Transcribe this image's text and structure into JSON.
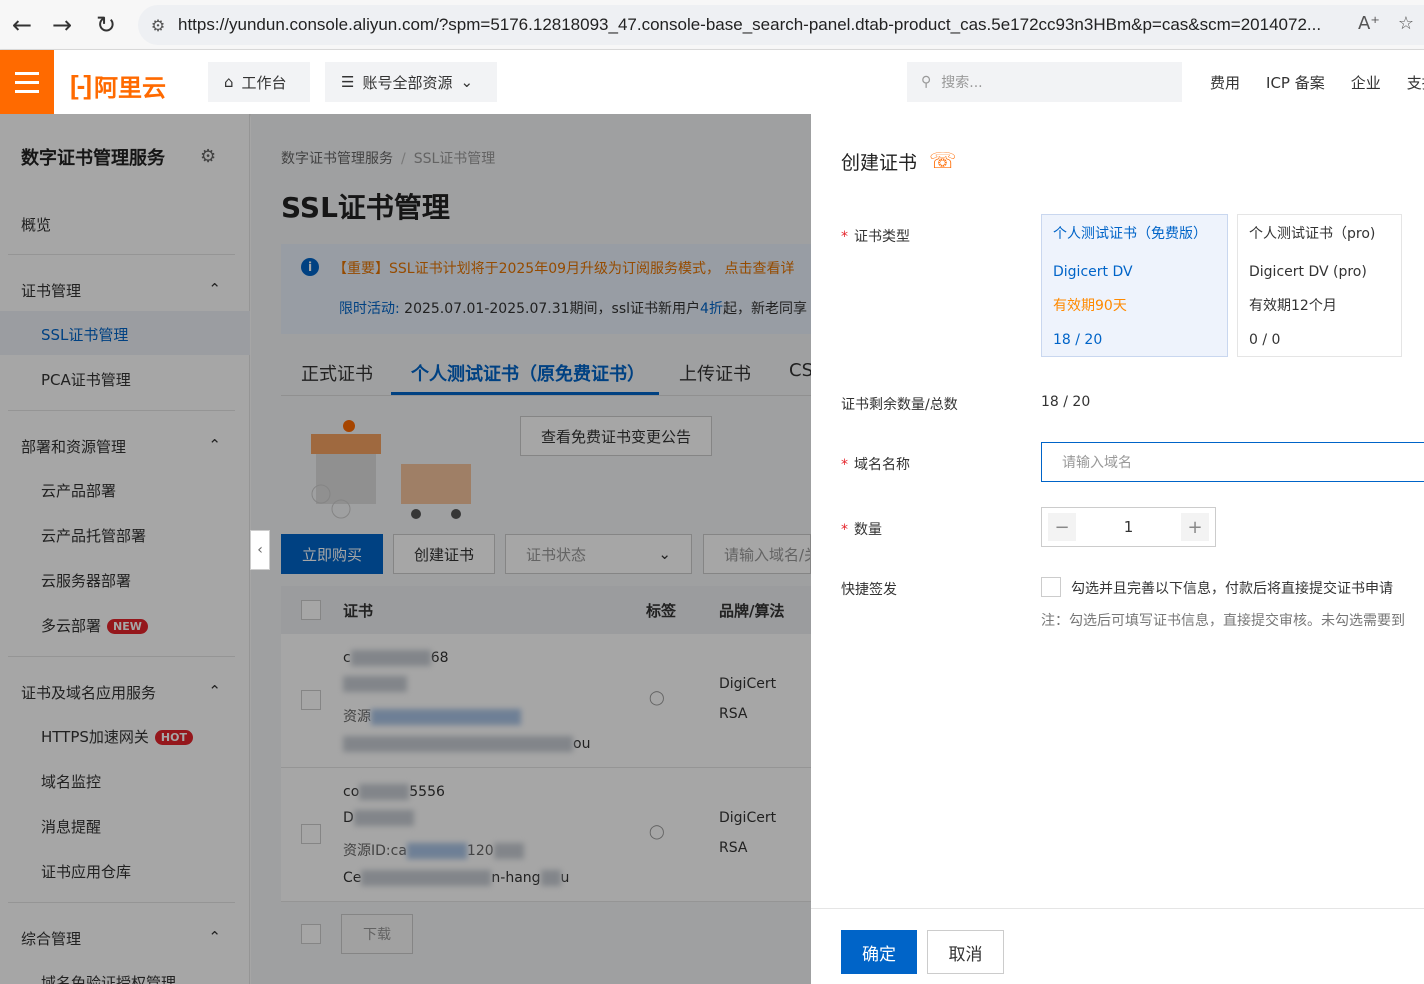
{
  "browser": {
    "url": "https://yundun.console.aliyun.com/?spm=5176.12818093_47.console-base_search-panel.dtab-product_cas.5e172cc93n3HBm&p=cas&scm=2014072..."
  },
  "topnav": {
    "logo": "阿里云",
    "workbench": "工作台",
    "resources": "账号全部资源",
    "search_placeholder": "搜索...",
    "links": [
      "费用",
      "ICP 备案",
      "企业",
      "支持"
    ]
  },
  "sidebar": {
    "title": "数字证书管理服务",
    "overview": "概览",
    "groups": [
      {
        "label": "证书管理",
        "items": [
          "SSL证书管理",
          "PCA证书管理"
        ]
      },
      {
        "label": "部署和资源管理",
        "items": [
          "云产品部署",
          "云产品托管部署",
          "云服务器部署",
          "多云部署"
        ]
      },
      {
        "label": "证书及域名应用服务",
        "items": [
          "HTTPS加速网关",
          "域名监控",
          "消息提醒",
          "证书应用仓库"
        ]
      },
      {
        "label": "综合管理",
        "items": [
          "域名免验证授权管理"
        ]
      }
    ],
    "badge_new": "NEW",
    "badge_hot": "HOT"
  },
  "main": {
    "breadcrumb": [
      "数字证书管理服务",
      "SSL证书管理"
    ],
    "title": "SSL证书管理",
    "notice1": "【重要】SSL证书计划将于2025年09月升级为订阅服务模式， 点击查看详",
    "notice2_prefix": "限时活动:",
    "notice2": "2025.07.01-2025.07.31期间，ssl证书新用户",
    "notice2_discount": "4折",
    "notice2_suffix": "起，新老同享",
    "tabs": [
      "正式证书",
      "个人测试证书（原免费证书）",
      "上传证书",
      "CS"
    ],
    "announcement_btn": "查看免费证书变更公告",
    "buy_btn": "立即购买",
    "create_btn": "创建证书",
    "status_select": "证书状态",
    "search_placeholder": "请输入域名/关",
    "table_headers": [
      "证书",
      "标签",
      "品牌/算法"
    ],
    "rows": [
      {
        "brand": "DigiCert",
        "algo": "RSA",
        "line1_start": "c",
        "line1_end": "68",
        "line3_start": "资源",
        "line4_end": "ou"
      },
      {
        "brand": "DigiCert",
        "algo": "RSA",
        "line1_start": "co",
        "line1_end": "5556",
        "line2_start": "D",
        "line3_start": "资源ID:ca",
        "line3_mid": "120",
        "line4_start": "Ce",
        "line4_mid": "n-hang",
        "line4_end": "u"
      }
    ],
    "download_btn": "下载"
  },
  "drawer": {
    "title": "创建证书",
    "cert_type_label": "证书类型",
    "cards": [
      {
        "name": "个人测试证书（免费版）",
        "product": "Digicert DV",
        "validity": "有效期90天",
        "count": "18 / 20"
      },
      {
        "name": "个人测试证书（pro)",
        "product": "Digicert DV (pro)",
        "validity": "有效期12个月",
        "count": "0 / 0"
      }
    ],
    "remaining_label": "证书剩余数量/总数",
    "remaining_value": "18 / 20",
    "domain_label": "域名名称",
    "domain_placeholder": "请输入域名",
    "quantity_label": "数量",
    "quantity_value": "1",
    "quick_label": "快捷签发",
    "quick_text": "勾选并且完善以下信息，付款后将直接提交证书申请",
    "quick_note": "注：勾选后可填写证书信息，直接提交审核。未勾选需要到",
    "confirm_btn": "确定",
    "cancel_btn": "取消"
  },
  "colors": {
    "brand": "#ff6a00",
    "primary": "#0064c8",
    "warning": "#ff8a00"
  }
}
